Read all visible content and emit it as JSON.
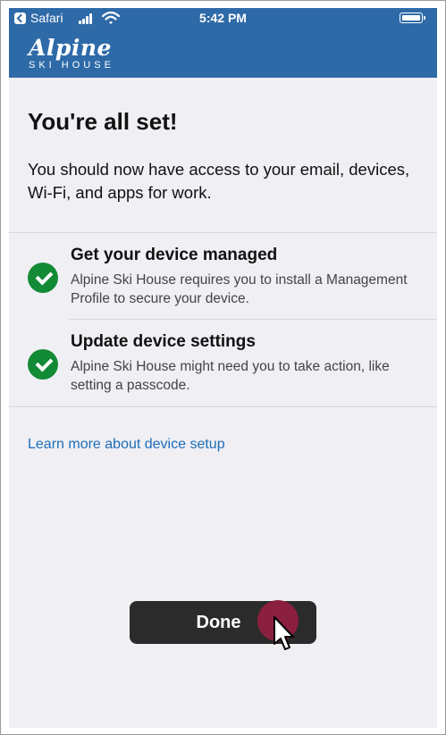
{
  "status_bar": {
    "carrier": "Safari",
    "time": "5:42 PM"
  },
  "header": {
    "logo_main": "Alpine",
    "logo_sub": "SKI HOUSE",
    "background_color": "#2e6aa8"
  },
  "main": {
    "title": "You're all set!",
    "description": "You should now have access to your email, devices, Wi-Fi, and apps for work.",
    "items": [
      {
        "icon": "checkmark-icon",
        "title": "Get your device managed",
        "description": "Alpine Ski House requires you to install a Management Profile to secure your device."
      },
      {
        "icon": "checkmark-icon",
        "title": "Update device settings",
        "description": "Alpine Ski House might need you to take action, like setting a passcode."
      }
    ],
    "link_text": "Learn more about device setup",
    "done_label": "Done"
  },
  "colors": {
    "accent": "#1f6db7",
    "success": "#138a36",
    "button": "#2b2b2b",
    "click_indicator": "#8b1f3f"
  }
}
